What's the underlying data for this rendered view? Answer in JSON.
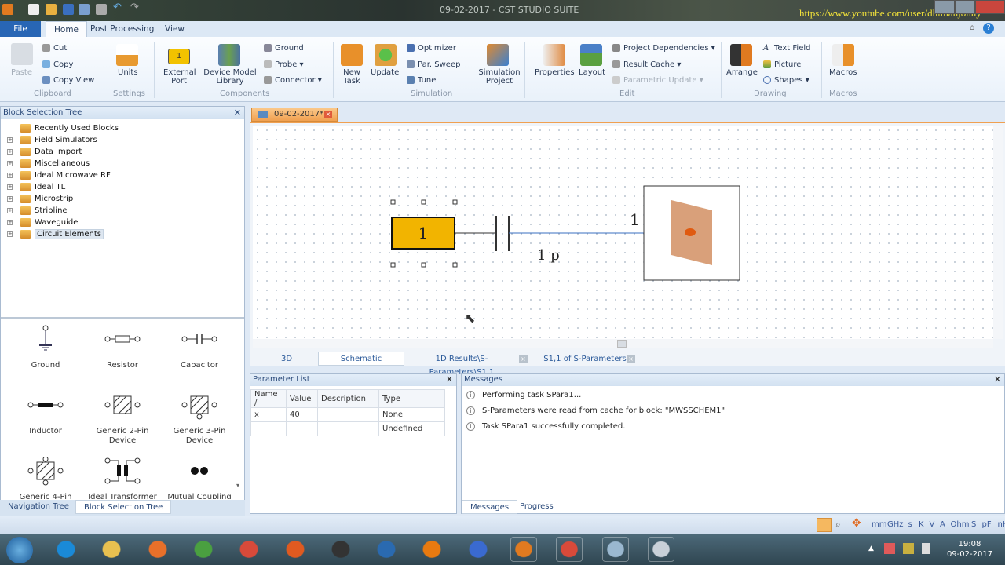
{
  "window": {
    "title": "09-02-2017 - CST STUDIO SUITE",
    "watermark_url": "https://www.youtube.com/user/dhimanjonny"
  },
  "ribbon": {
    "tabs": [
      "File",
      "Home",
      "Post Processing",
      "View"
    ],
    "clipboard": {
      "paste": "Paste",
      "cut": "Cut",
      "copy": "Copy",
      "copy_view": "Copy View",
      "group": "Clipboard"
    },
    "settings": {
      "units": "Units",
      "group": "Settings"
    },
    "components": {
      "external_port": "External Port",
      "device_model_library": "Device Model Library",
      "ground": "Ground",
      "probe": "Probe",
      "connector": "Connector",
      "group": "Components"
    },
    "simulation": {
      "new_task": "New Task",
      "update": "Update",
      "optimizer": "Optimizer",
      "par_sweep": "Par. Sweep",
      "tune": "Tune",
      "simulation_project": "Simulation Project",
      "group": "Simulation"
    },
    "edit": {
      "properties": "Properties",
      "layout": "Layout",
      "project_dependencies": "Project Dependencies",
      "result_cache": "Result Cache",
      "parametric_update": "Parametric Update",
      "group": "Edit"
    },
    "drawing": {
      "arrange": "Arrange",
      "text_field": "Text Field",
      "picture": "Picture",
      "shapes": "Shapes",
      "group": "Drawing"
    },
    "macros": {
      "macros": "Macros",
      "group": "Macros"
    }
  },
  "left_panel": {
    "title": "Block Selection Tree",
    "tree": [
      "Recently Used Blocks",
      "Field Simulators",
      "Data Import",
      "Miscellaneous",
      "Ideal Microwave RF",
      "Ideal TL",
      "Microstrip",
      "Stripline",
      "Waveguide",
      "Circuit Elements"
    ],
    "selected": "Circuit Elements",
    "gallery": [
      "Ground",
      "Resistor",
      "Capacitor",
      "Inductor",
      "Generic 2-Pin Device",
      "Generic 3-Pin Device",
      "Generic 4-Pin",
      "Ideal Transformer",
      "Mutual Coupling"
    ],
    "bottom_tabs": [
      "Navigation Tree",
      "Block Selection Tree"
    ]
  },
  "document_tab": "09-02-2017*",
  "schematic": {
    "port_label": "1",
    "capacitor_label": "1 p",
    "block_port_label": "1"
  },
  "view_tabs": [
    "3D",
    "Schematic",
    "1D Results\\S-Parameters\\S1,1",
    "S1,1 of S-Parameters"
  ],
  "parameter_list": {
    "title": "Parameter List",
    "columns": [
      "Name /",
      "Value",
      "Description",
      "Type"
    ],
    "rows": [
      [
        "x",
        "40",
        "",
        "None"
      ],
      [
        "",
        "",
        "",
        "Undefined"
      ]
    ]
  },
  "messages": {
    "title": "Messages",
    "items": [
      "Performing task SPara1...",
      "S-Parameters were read from cache for block: \"MWSSCHEM1\"",
      "Task SPara1 successfully completed."
    ],
    "tabs": [
      "Messages",
      "Progress"
    ]
  },
  "status_units": [
    "mm",
    "GHz",
    "s",
    "K",
    "V",
    "A",
    "Ohm",
    "S",
    "pF",
    "nH"
  ],
  "clock": {
    "time": "19:08",
    "date": "09-02-2017"
  },
  "colors": {
    "accent": "#2866b5",
    "port_fill": "#f2b400",
    "doc_tab": "#f0a050"
  }
}
